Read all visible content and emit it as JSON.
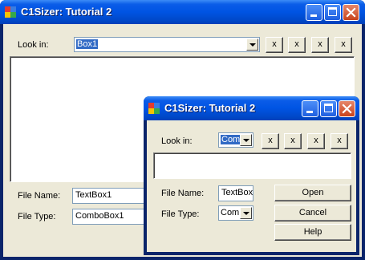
{
  "main_window": {
    "title": "C1Sizer: Tutorial 2",
    "look_in_label": "Look in:",
    "look_in_value": "Box1",
    "file_name_label": "File Name:",
    "file_name_value": "TextBox1",
    "file_type_label": "File Type:",
    "file_type_value": "ComboBox1",
    "x_buttons": [
      "x",
      "x",
      "x",
      "x"
    ]
  },
  "child_window": {
    "title": "C1Sizer: Tutorial 2",
    "look_in_label": "Look in:",
    "look_in_value": "Com",
    "file_name_label": "File Name:",
    "file_name_value": "TextBox",
    "file_type_label": "File Type:",
    "file_type_value": "Com",
    "x_buttons": [
      "x",
      "x",
      "x",
      "x"
    ],
    "open_label": "Open",
    "cancel_label": "Cancel",
    "help_label": "Help"
  },
  "icons": {
    "app": "app-icon",
    "minimize": "minimize-icon",
    "maximize": "maximize-icon",
    "close": "close-icon",
    "dropdown": "chevron-down-icon"
  },
  "colors": {
    "titlebar_blue": "#0054e3",
    "close_red": "#c8431c",
    "dialog_face": "#ece9d8",
    "selection": "#316ac5"
  }
}
